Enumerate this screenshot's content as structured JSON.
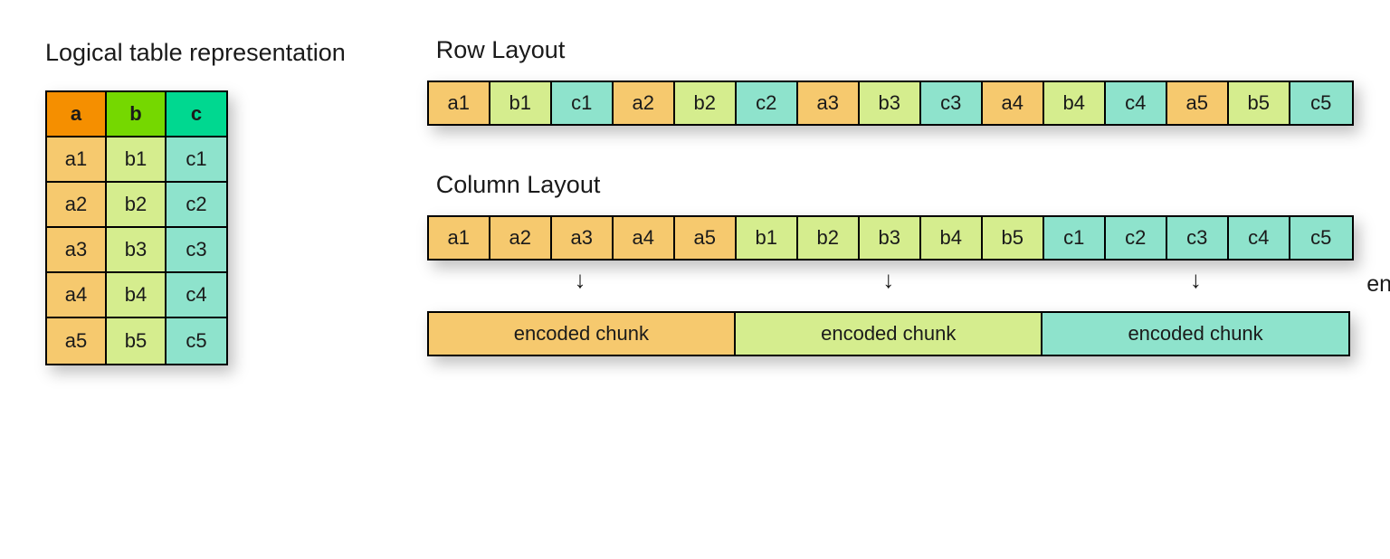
{
  "titles": {
    "logical": "Logical table representation",
    "row_layout": "Row Layout",
    "column_layout": "Column Layout",
    "encoding": "encoding"
  },
  "colors": {
    "header_a": "#f58f00",
    "header_b": "#75d800",
    "header_c": "#00d890",
    "col_a": "#f6c96e",
    "col_b": "#d5ed8e",
    "col_c": "#8ee3cc"
  },
  "logical_table": {
    "headers": [
      "a",
      "b",
      "c"
    ],
    "rows": [
      [
        "a1",
        "b1",
        "c1"
      ],
      [
        "a2",
        "b2",
        "c2"
      ],
      [
        "a3",
        "b3",
        "c3"
      ],
      [
        "a4",
        "b4",
        "c4"
      ],
      [
        "a5",
        "b5",
        "c5"
      ]
    ]
  },
  "row_layout_cells": [
    {
      "v": "a1",
      "c": "cA"
    },
    {
      "v": "b1",
      "c": "cB"
    },
    {
      "v": "c1",
      "c": "cC"
    },
    {
      "v": "a2",
      "c": "cA"
    },
    {
      "v": "b2",
      "c": "cB"
    },
    {
      "v": "c2",
      "c": "cC"
    },
    {
      "v": "a3",
      "c": "cA"
    },
    {
      "v": "b3",
      "c": "cB"
    },
    {
      "v": "c3",
      "c": "cC"
    },
    {
      "v": "a4",
      "c": "cA"
    },
    {
      "v": "b4",
      "c": "cB"
    },
    {
      "v": "c4",
      "c": "cC"
    },
    {
      "v": "a5",
      "c": "cA"
    },
    {
      "v": "b5",
      "c": "cB"
    },
    {
      "v": "c5",
      "c": "cC"
    }
  ],
  "column_layout_cells": [
    {
      "v": "a1",
      "c": "cA"
    },
    {
      "v": "a2",
      "c": "cA"
    },
    {
      "v": "a3",
      "c": "cA"
    },
    {
      "v": "a4",
      "c": "cA"
    },
    {
      "v": "a5",
      "c": "cA"
    },
    {
      "v": "b1",
      "c": "cB"
    },
    {
      "v": "b2",
      "c": "cB"
    },
    {
      "v": "b3",
      "c": "cB"
    },
    {
      "v": "b4",
      "c": "cB"
    },
    {
      "v": "b5",
      "c": "cB"
    },
    {
      "v": "c1",
      "c": "cC"
    },
    {
      "v": "c2",
      "c": "cC"
    },
    {
      "v": "c3",
      "c": "cC"
    },
    {
      "v": "c4",
      "c": "cC"
    },
    {
      "v": "c5",
      "c": "cC"
    }
  ],
  "encoded_chunks": [
    {
      "label": "encoded chunk",
      "c": "cA"
    },
    {
      "label": "encoded chunk",
      "c": "cB"
    },
    {
      "label": "encoded chunk",
      "c": "cC"
    }
  ]
}
